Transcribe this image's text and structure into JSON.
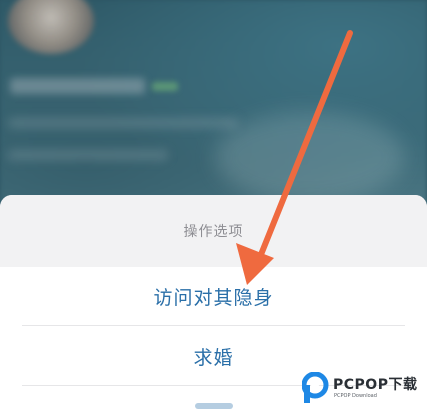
{
  "action_sheet": {
    "title": "操作选项",
    "options": [
      {
        "label": "访问对其隐身"
      },
      {
        "label": "求婚"
      }
    ]
  },
  "watermark": {
    "brand": "PCPOP下载",
    "sub": "PCPOP Download"
  },
  "colors": {
    "option_text": "#2a6fa8",
    "arrow": "#ef6a3f",
    "background": "#2c5563"
  },
  "icons": [
    "annotation-arrow-icon",
    "pcpop-logo-icon"
  ]
}
